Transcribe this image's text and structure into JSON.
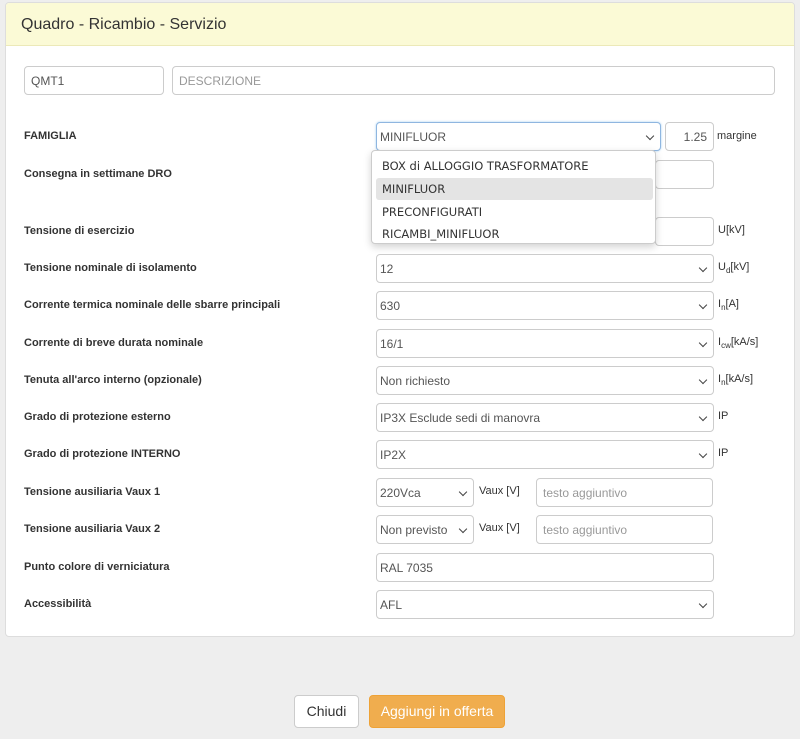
{
  "dialog": {
    "title": "Quadro - Ricambio - Servizio"
  },
  "header": {
    "code_value": "QMT1",
    "description_placeholder": "DESCRIZIONE"
  },
  "fields": {
    "famiglia": {
      "label": "FAMIGLIA",
      "value": "MINIFLUOR",
      "margin_value": "1.25",
      "margin_unit": "margine"
    },
    "consegna": {
      "label": "Consegna in settimane DRO"
    },
    "tensione_esercizio": {
      "label": "Tensione di esercizio",
      "unit": "U[kV]"
    },
    "tensione_isolamento": {
      "label": "Tensione nominale di isolamento",
      "value": "12",
      "unit_main": "U",
      "unit_sub": "d",
      "unit_rest": "[kV]"
    },
    "corrente_termica": {
      "label": "Corrente termica nominale delle sbarre principali",
      "value": "630",
      "unit_main": "I",
      "unit_sub": "n",
      "unit_rest": "[A]"
    },
    "corrente_breve": {
      "label": "Corrente di breve durata nominale",
      "value": "16/1",
      "unit_main": "I",
      "unit_sub": "cw",
      "unit_rest": "[kA/s]"
    },
    "tenuta_arco": {
      "label": "Tenuta all'arco interno (opzionale)",
      "value": "Non richiesto",
      "unit_main": "I",
      "unit_sub": "n",
      "unit_rest": "[kA/s]"
    },
    "protezione_esterno": {
      "label": "Grado di protezione esterno",
      "value": "IP3X Esclude sedi di manovra",
      "unit": "IP"
    },
    "protezione_interno": {
      "label": "Grado di protezione INTERNO",
      "value": "IP2X",
      "unit": "IP"
    },
    "vaux1": {
      "label": "Tensione ausiliaria Vaux 1",
      "value": "220Vca",
      "unit": "Vaux [V]",
      "extra_placeholder": "testo aggiuntivo"
    },
    "vaux2": {
      "label": "Tensione ausiliaria Vaux 2",
      "value": "Non previsto",
      "unit": "Vaux [V]",
      "extra_placeholder": "testo aggiuntivo"
    },
    "colore": {
      "label": "Punto colore di verniciatura",
      "value": "RAL 7035"
    },
    "accessibilita": {
      "label": "Accessibilità",
      "value": "AFL"
    }
  },
  "famiglia_dropdown": {
    "options": [
      "BOX di ALLOGGIO TRASFORMATORE",
      "MINIFLUOR",
      "PRECONFIGURATI",
      "RICAMBI_MINIFLUOR"
    ],
    "selected": "MINIFLUOR"
  },
  "footer": {
    "close_label": "Chiudi",
    "add_label": "Aggiungi in offerta",
    "add_color": "#f0ad4e"
  },
  "icons": {
    "select_arrow": "chevron-down-icon"
  }
}
